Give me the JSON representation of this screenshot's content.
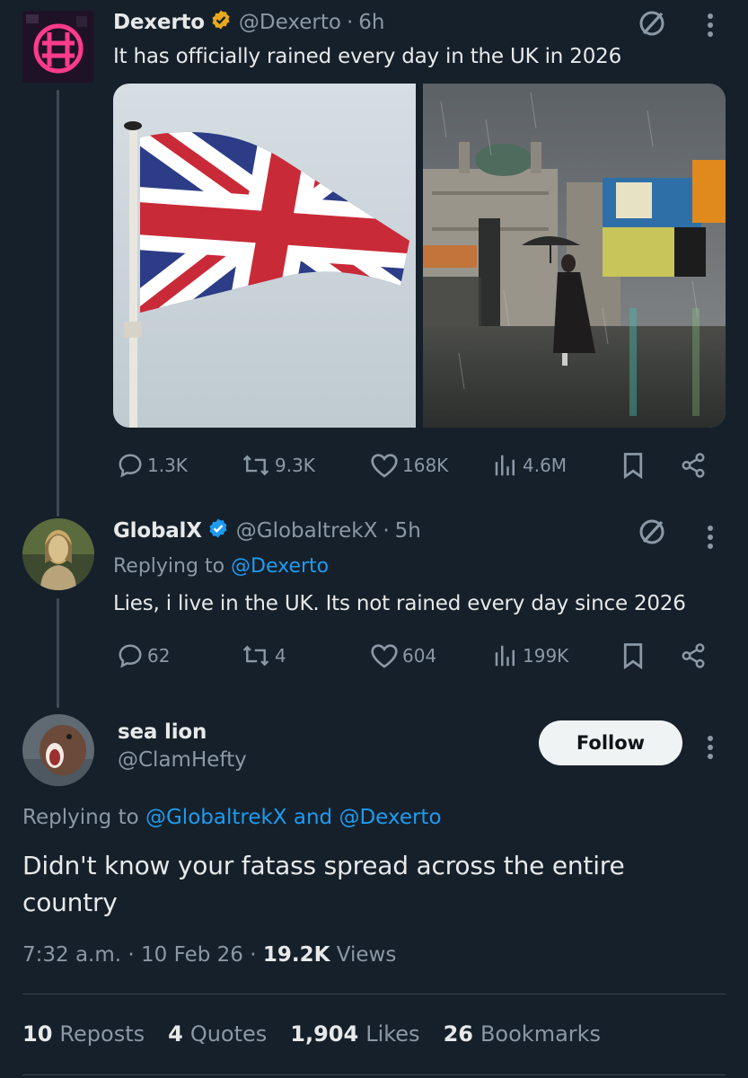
{
  "tweet1": {
    "name": "Dexerto",
    "handle": "@Dexerto",
    "time": "6h",
    "text": "It has officially rained every day in the UK in 2026",
    "actions": {
      "replies": "1.3K",
      "reposts": "9.3K",
      "likes": "168K",
      "views": "4.6M"
    },
    "media": [
      {
        "alt": "Union Jack flag"
      },
      {
        "alt": "Rainy street with woman holding umbrella"
      }
    ]
  },
  "tweet2": {
    "name": "GlobalX",
    "handle": "@GlobaltrekX",
    "time": "5h",
    "replying_label": "Replying to",
    "replying_to": "@Dexerto",
    "text": "Lies, i live in the UK. Its not rained every day since 2026",
    "actions": {
      "replies": "62",
      "reposts": "4",
      "likes": "604",
      "views": "199K"
    }
  },
  "main": {
    "name": "sea lion",
    "handle": "@ClamHefty",
    "follow_label": "Follow",
    "replying_label": "Replying to",
    "replying_to_1": "@GlobaltrekX",
    "replying_and": "and",
    "replying_to_2": "@Dexerto",
    "text": "Didn't know your fatass spread across the entire country",
    "time": "7:32 a.m.",
    "date": "10 Feb 26",
    "views_count": "19.2K",
    "views_label": "Views",
    "stats": [
      {
        "count": "10",
        "label": "Reposts"
      },
      {
        "count": "4",
        "label": "Quotes"
      },
      {
        "count": "1,904",
        "label": "Likes"
      },
      {
        "count": "26",
        "label": "Bookmarks"
      }
    ]
  },
  "colors": {
    "background": "#16202a",
    "accent": "#1d9bf0",
    "muted": "#8b98a5",
    "gold_badge": "#e8a91c"
  }
}
